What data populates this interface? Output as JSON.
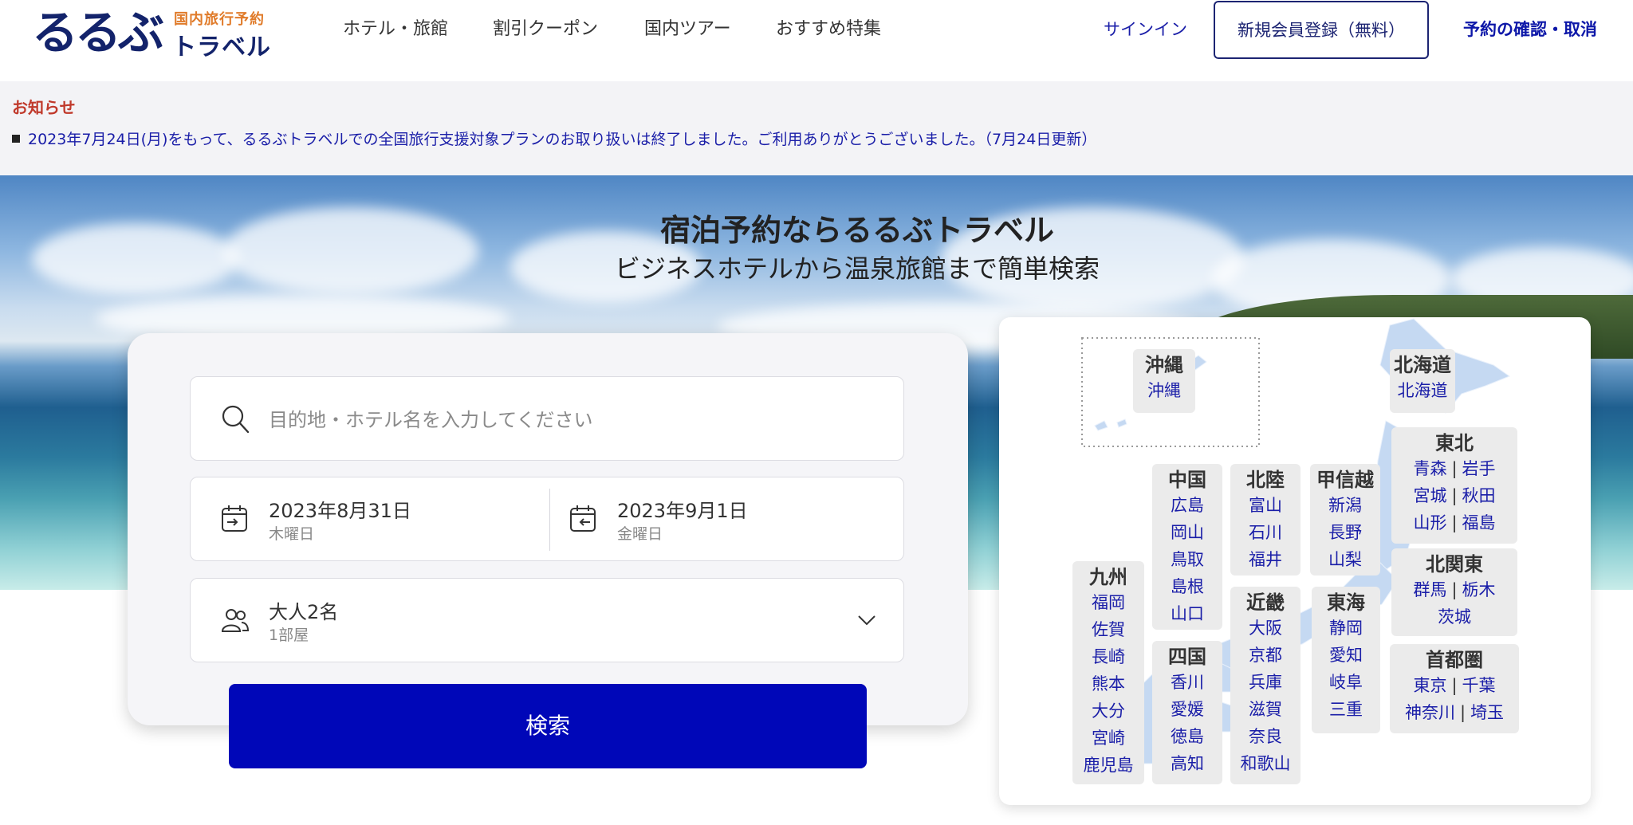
{
  "logo": {
    "main": "るるぶ",
    "sub_top": "国内旅行予約",
    "sub_bottom": "トラベル"
  },
  "nav": {
    "items": [
      "ホテル・旅館",
      "割引クーポン",
      "国内ツアー",
      "おすすめ特集"
    ],
    "signin": "サインイン",
    "register": "新規会員登録（無料）",
    "reservations": "予約の確認・取消"
  },
  "notice": {
    "title": "お知らせ",
    "text": "2023年7月24日(月)をもって、るるぶトラベルでの全国旅行支援対象プランのお取り扱いは終了しました。ご利用ありがとうございました。（7月24日更新）"
  },
  "hero": {
    "title": "宿泊予約ならるるぶトラベル",
    "subtitle": "ビジネスホテルから温泉旅館まで簡単検索"
  },
  "search": {
    "placeholder": "目的地・ホテル名を入力してください",
    "checkin": {
      "date": "2023年8月31日",
      "weekday": "木曜日"
    },
    "checkout": {
      "date": "2023年9月1日",
      "weekday": "金曜日"
    },
    "guests": {
      "people": "大人2名",
      "rooms": "1部屋"
    },
    "button": "検索"
  },
  "icons": {
    "search": "search-icon",
    "checkin": "calendar-checkin-icon",
    "checkout": "calendar-checkout-icon",
    "guests": "people-icon",
    "dropdown": "chevron-down-icon"
  },
  "map": {
    "okinawa": {
      "title": "沖縄",
      "prefs": [
        "沖縄"
      ]
    },
    "hokkaido": {
      "title": "北海道",
      "prefs": [
        "北海道"
      ]
    },
    "tohoku": {
      "title": "東北",
      "prefs": [
        "青森",
        "岩手",
        "宮城",
        "秋田",
        "山形",
        "福島"
      ]
    },
    "kitakanto": {
      "title": "北関東",
      "prefs": [
        "群馬",
        "栃木",
        "茨城"
      ]
    },
    "shutoken": {
      "title": "首都圏",
      "prefs": [
        "東京",
        "千葉",
        "神奈川",
        "埼玉"
      ]
    },
    "koshinetsu": {
      "title": "甲信越",
      "prefs": [
        "新潟",
        "長野",
        "山梨"
      ]
    },
    "tokai": {
      "title": "東海",
      "prefs": [
        "静岡",
        "愛知",
        "岐阜",
        "三重"
      ]
    },
    "hokuriku": {
      "title": "北陸",
      "prefs": [
        "富山",
        "石川",
        "福井"
      ]
    },
    "kinki": {
      "title": "近畿",
      "prefs": [
        "大阪",
        "京都",
        "兵庫",
        "滋賀",
        "奈良",
        "和歌山"
      ]
    },
    "chugoku": {
      "title": "中国",
      "prefs": [
        "広島",
        "岡山",
        "鳥取",
        "島根",
        "山口"
      ]
    },
    "shikoku": {
      "title": "四国",
      "prefs": [
        "香川",
        "愛媛",
        "徳島",
        "高知"
      ]
    },
    "kyushu": {
      "title": "九州",
      "prefs": [
        "福岡",
        "佐賀",
        "長崎",
        "熊本",
        "大分",
        "宮崎",
        "鹿児島"
      ]
    }
  },
  "colors": {
    "brand_navy": "#13236b",
    "accent_orange": "#e07b2a",
    "link_blue": "#1a1ea8",
    "search_button": "#0007b8"
  }
}
